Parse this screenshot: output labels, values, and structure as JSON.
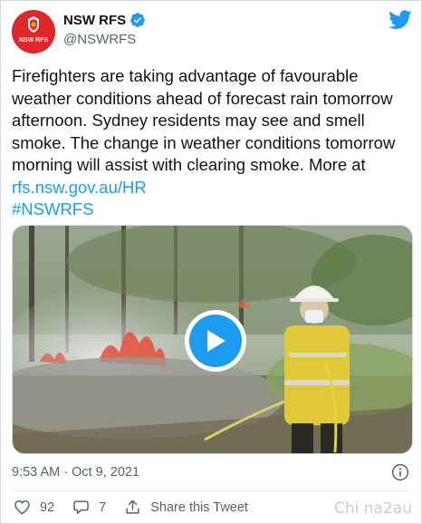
{
  "tweet": {
    "display_name": "NSW RFS",
    "handle": "@NSWRFS",
    "avatar_text": "NSW RFS",
    "text_part1": "Firefighters are taking advantage of favourable weather conditions ahead of forecast rain tomorrow afternoon. Sydney residents may see and smell smoke. The change in weather conditions tomorrow morning will assist with clearing smoke. More at ",
    "link": "rfs.nsw.gov.au/HR",
    "hashtag": "#NSWRFS",
    "timestamp": "9:53 AM · Oct 9, 2021",
    "likes": "92",
    "replies": "7",
    "share_label": "Share this Tweet"
  },
  "icons": {
    "verified": "verified-badge-icon",
    "twitter": "twitter-bird-icon",
    "play": "play-icon",
    "info": "info-icon",
    "like": "heart-icon",
    "reply": "reply-bubble-icon",
    "share": "share-upload-icon"
  },
  "colors": {
    "accent": "#1d9bf0",
    "brand_red": "#e0262b",
    "text": "#0f1419",
    "muted": "#536471"
  },
  "watermark": "Chi  na2au"
}
